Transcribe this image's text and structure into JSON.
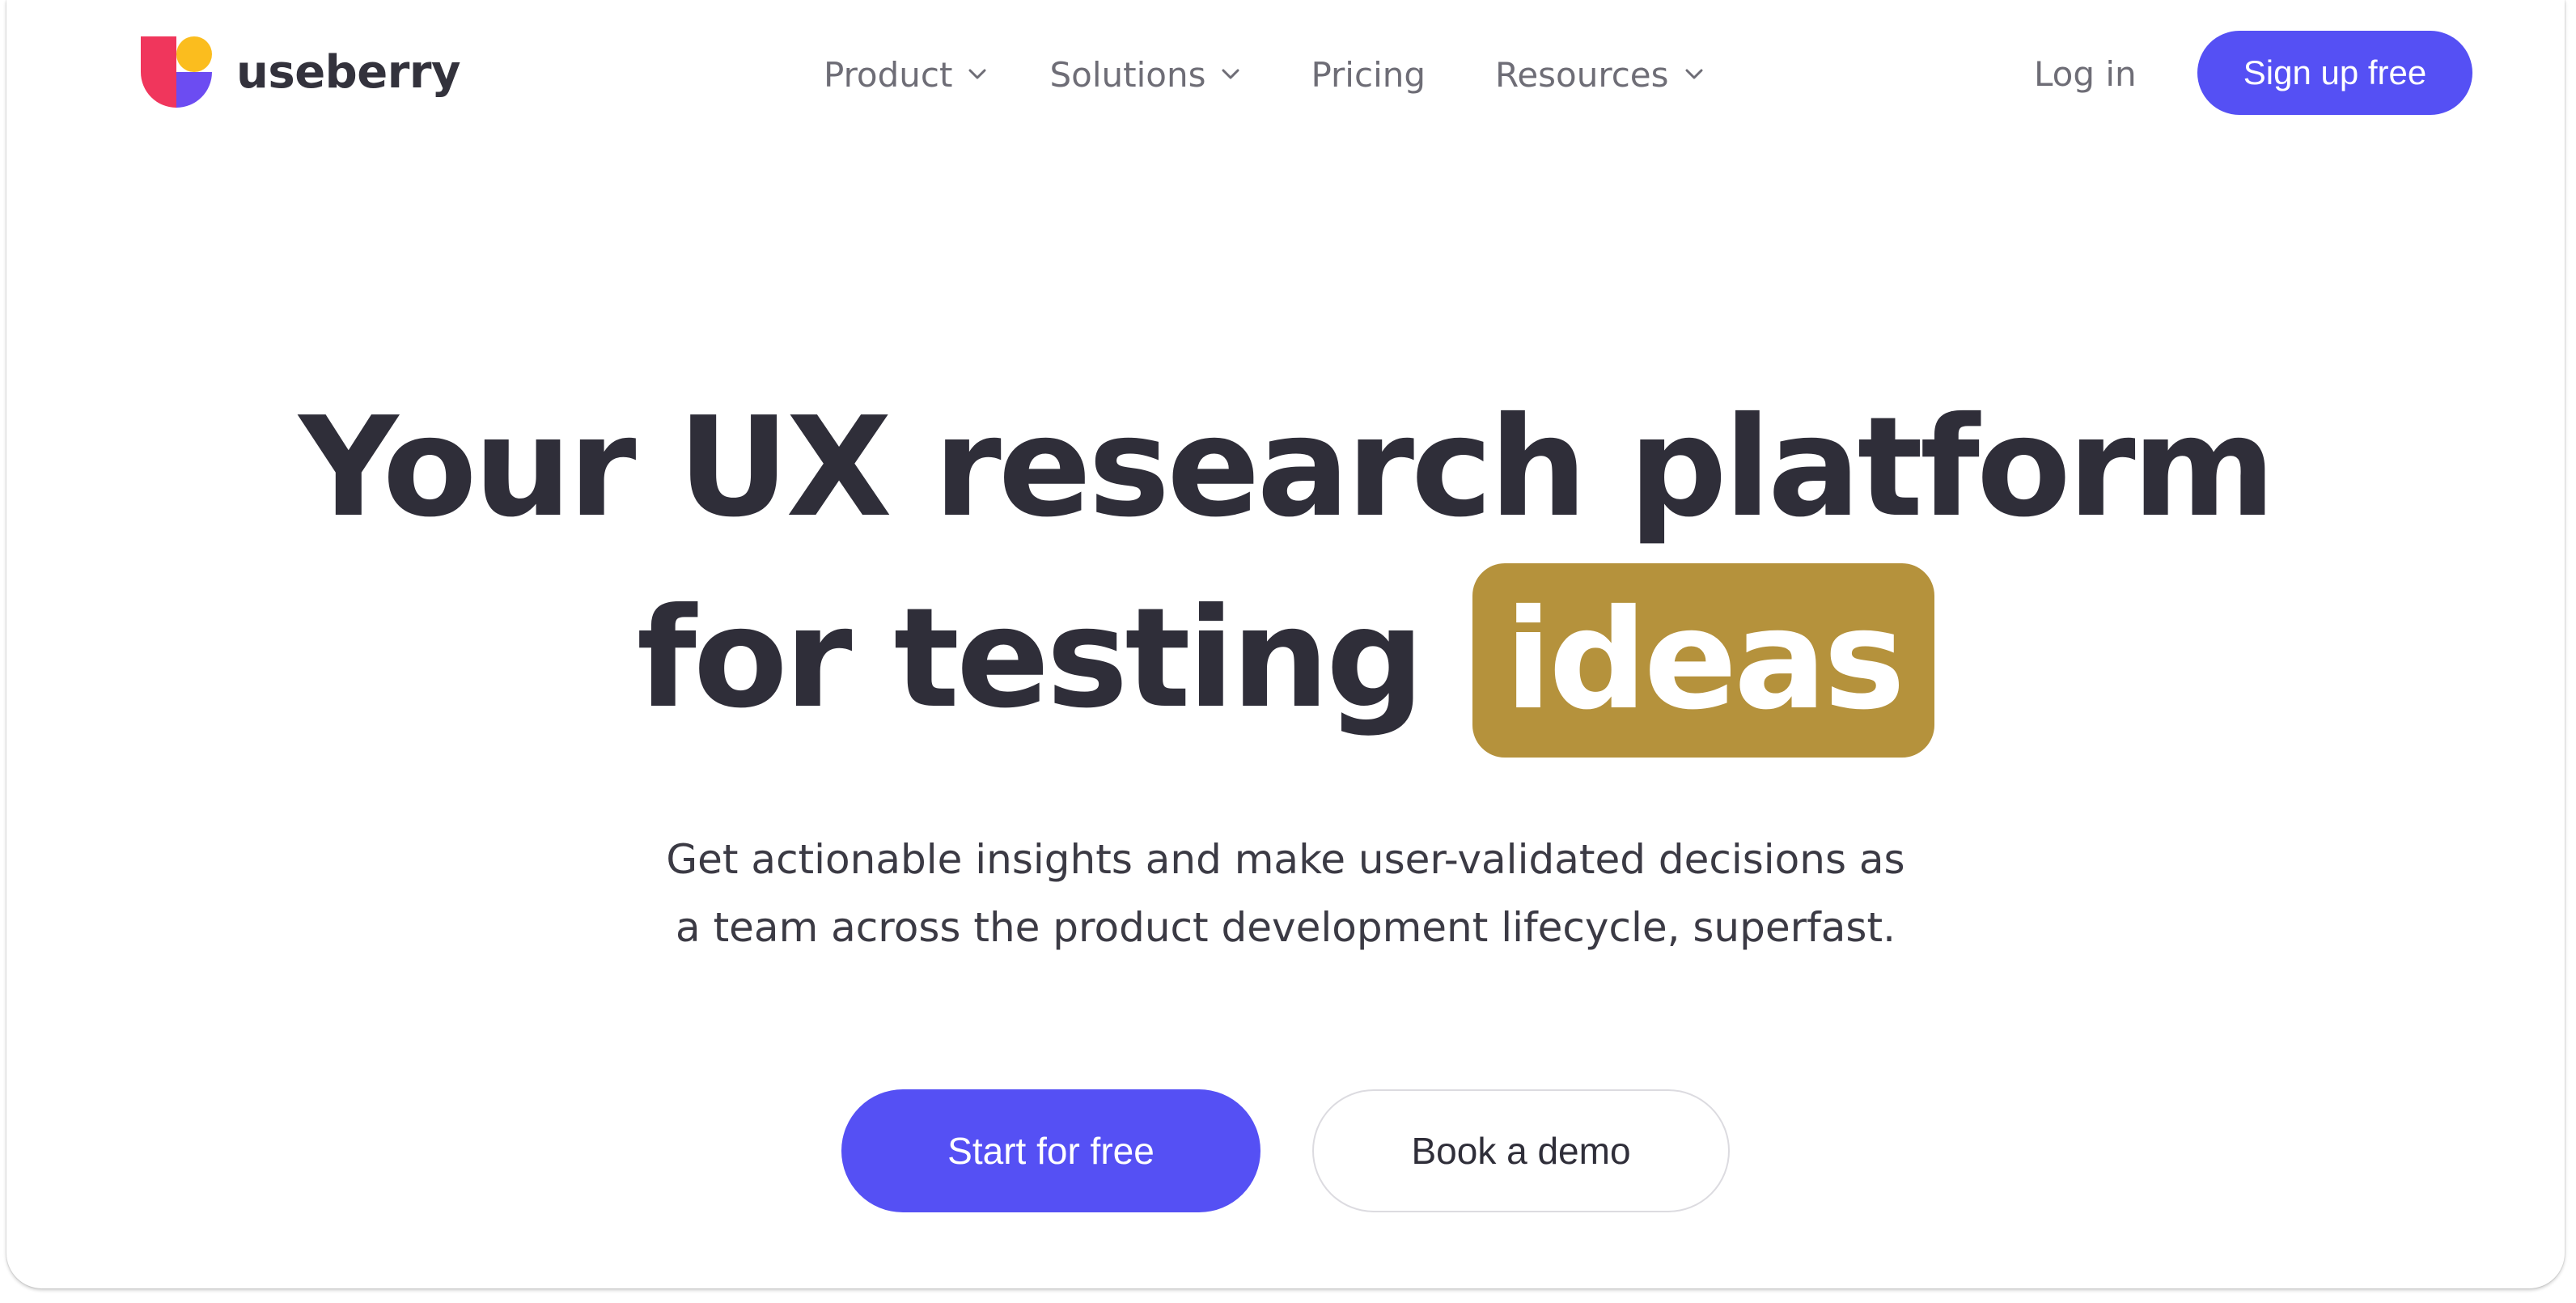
{
  "nav": {
    "brand": "useberry",
    "items": [
      {
        "label": "Product",
        "has_dropdown": true
      },
      {
        "label": "Solutions",
        "has_dropdown": true
      },
      {
        "label": "Pricing",
        "has_dropdown": false
      },
      {
        "label": "Resources",
        "has_dropdown": true
      }
    ],
    "login_label": "Log in",
    "signup_label": "Sign up free"
  },
  "hero": {
    "title_line1": "Your UX research platform",
    "title_line2_prefix": "for testing",
    "title_highlight": "ideas",
    "subtitle_line1": "Get actionable insights and make user-validated decisions as",
    "subtitle_line2": "a team across the product development lifecycle, superfast.",
    "primary_cta": "Start for free",
    "secondary_cta": "Book a demo"
  },
  "colors": {
    "accent": "#5550f4",
    "highlight": "#b5923c",
    "heading": "#2f2e39",
    "nav_text": "#6e6d76",
    "logo_red": "#f0365c",
    "logo_yellow": "#fbbd1e",
    "logo_purple": "#6c4cf2"
  },
  "icons": {
    "logo": "useberry-logo-icon",
    "dropdown": "chevron-down-icon"
  }
}
